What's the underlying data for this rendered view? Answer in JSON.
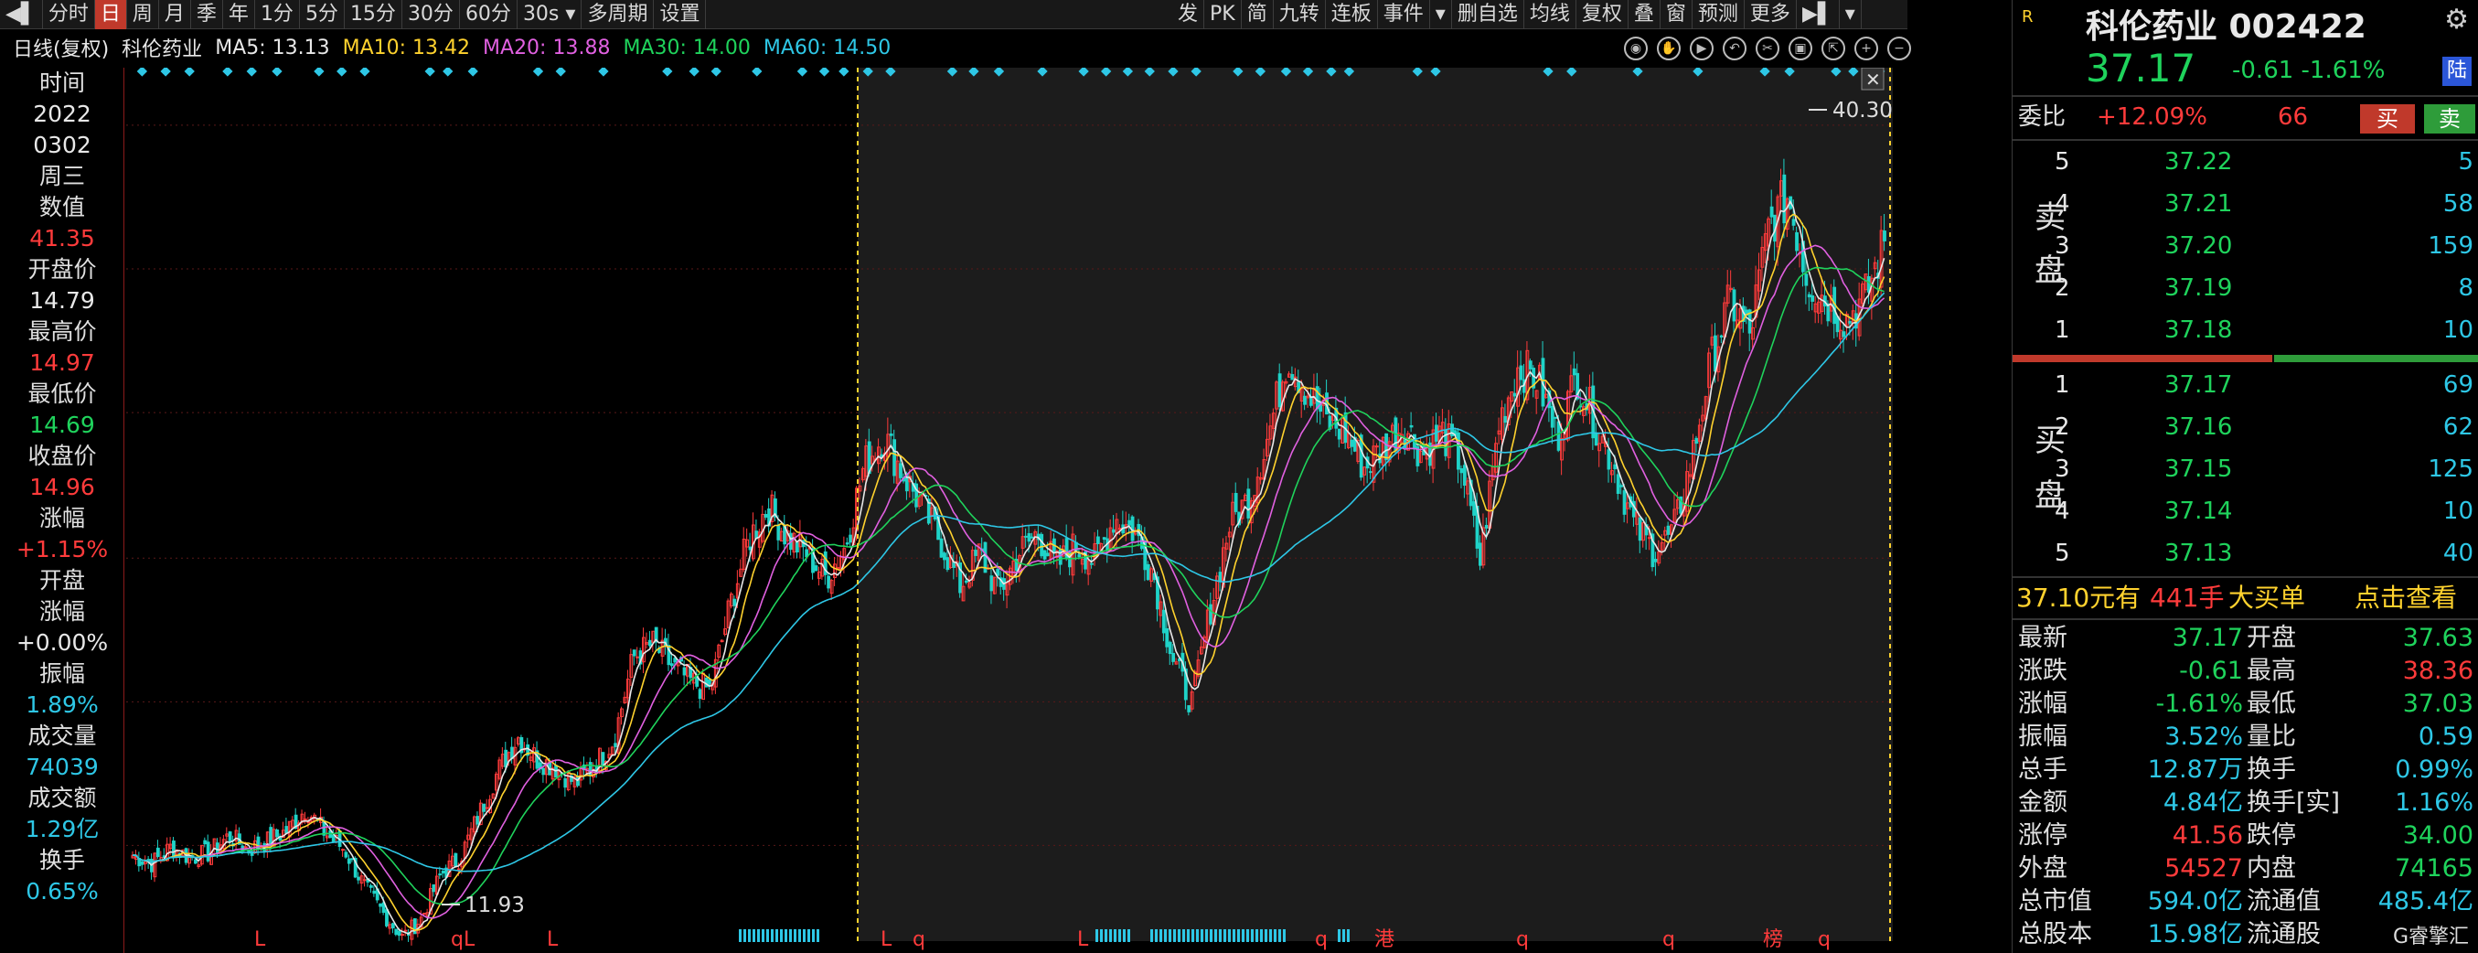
{
  "toolbar": {
    "left_items": [
      "分时",
      "日",
      "周",
      "月",
      "季",
      "年",
      "1分",
      "5分",
      "15分",
      "30分",
      "60分",
      "30s",
      "多周期",
      "设置"
    ],
    "active": "日",
    "right_items": [
      "发",
      "PK",
      "简",
      "九转",
      "连板",
      "事件",
      "删自选",
      "均线",
      "复权",
      "叠",
      "窗",
      "预测",
      "更多"
    ]
  },
  "chart_head": {
    "name": "日线(复权)",
    "stock": "科伦药业",
    "ma5": "MA5: 13.13",
    "ma10": "MA10: 13.42",
    "ma20": "MA20: 13.88",
    "ma30": "MA30: 14.00",
    "ma60": "MA60: 14.50",
    "colors": {
      "ma5": "#e8e8e8",
      "ma10": "#ffd22e",
      "ma20": "#e060e0",
      "ma30": "#1fd35c",
      "ma60": "#2ec7e6"
    }
  },
  "info": {
    "time_label": "时间",
    "year": "2022",
    "date": "0302",
    "weekday": "周三",
    "value_label": "数值",
    "value": "41.35",
    "open_label": "开盘价",
    "open": "14.79",
    "high_label": "最高价",
    "high": "14.97",
    "low_label": "最低价",
    "low": "14.69",
    "close_label": "收盘价",
    "close": "14.96",
    "chg_label": "涨幅",
    "chg": "+1.15%",
    "open_chg_label1": "开盘",
    "open_chg_label2": "涨幅",
    "open_chg": "+0.00%",
    "amp_label": "振幅",
    "amp": "1.89%",
    "vol_label": "成交量",
    "vol": "74039",
    "amt_label": "成交额",
    "amt": "1.29亿",
    "turn_label": "换手",
    "turn": "0.65%"
  },
  "chart_data": {
    "type": "candlestick",
    "price_axis": [
      "41.87",
      "36.64",
      "31.41",
      "26.11",
      "20.88",
      "15.65"
    ],
    "ylim": [
      13.5,
      42.5
    ],
    "annotations": {
      "max": "40.30",
      "min": "11.93"
    },
    "bottom_markers": [
      "L",
      "q",
      "L",
      "qL",
      "L",
      "L",
      "q",
      "L",
      "q",
      "港",
      "q",
      "q",
      "榜",
      "q"
    ],
    "close_path": [
      15.3,
      15.0,
      15.6,
      15.2,
      15.4,
      16.0,
      15.5,
      15.8,
      16.2,
      17.0,
      16.1,
      15.5,
      14.2,
      13.2,
      12.3,
      13.0,
      14.6,
      15.2,
      16.8,
      18.4,
      19.6,
      18.8,
      18.5,
      17.9,
      18.6,
      19.5,
      22.5,
      23.0,
      22.2,
      21.6,
      21.3,
      24.3,
      26.8,
      28.0,
      26.9,
      26.3,
      25.4,
      26.5,
      29.5,
      30.6,
      29.2,
      28.0,
      26.7,
      25.1,
      26.3,
      24.8,
      26.3,
      27.0,
      25.8,
      26.6,
      26.0,
      27.6,
      27.1,
      25.6,
      22.5,
      20.8,
      24.3,
      27.4,
      28.3,
      30.6,
      33.5,
      32.2,
      31.1,
      30.7,
      29.4,
      30.2,
      31.0,
      29.9,
      30.7,
      29.6,
      26.0,
      31.1,
      33.1,
      32.6,
      30.5,
      32.8,
      31.0,
      29.4,
      27.3,
      26.4,
      27.0,
      29.7,
      33.3,
      35.5,
      34.2,
      38.2,
      39.3,
      36.3,
      35.5,
      34.8,
      35.6,
      37.6
    ]
  },
  "quote": {
    "r_label": "R",
    "title": "科伦药业  002422",
    "price": "37.17",
    "change": "-0.61  -1.61%",
    "market": "陆",
    "weibi_label": "委比",
    "weibi": "+12.09%",
    "weibi_diff": "66",
    "buy_btn": "买",
    "sell_btn": "卖",
    "sell_label1": "卖",
    "sell_label2": "盘",
    "buy_label1": "买",
    "buy_label2": "盘",
    "sells": [
      {
        "n": "5",
        "p": "37.22",
        "v": "5"
      },
      {
        "n": "4",
        "p": "37.21",
        "v": "58"
      },
      {
        "n": "3",
        "p": "37.20",
        "v": "159"
      },
      {
        "n": "2",
        "p": "37.19",
        "v": "8"
      },
      {
        "n": "1",
        "p": "37.18",
        "v": "10"
      }
    ],
    "buys": [
      {
        "n": "1",
        "p": "37.17",
        "v": "69"
      },
      {
        "n": "2",
        "p": "37.16",
        "v": "62"
      },
      {
        "n": "3",
        "p": "37.15",
        "v": "125"
      },
      {
        "n": "4",
        "p": "37.14",
        "v": "10"
      },
      {
        "n": "5",
        "p": "37.13",
        "v": "40"
      }
    ],
    "trade": {
      "price": "37.10元有",
      "qty": "441手",
      "big": "大买单",
      "view": "点击查看"
    },
    "stats": [
      {
        "k1": "最新",
        "v1": "37.17",
        "c1": "green",
        "k2": "开盘",
        "v2": "37.63",
        "c2": "green"
      },
      {
        "k1": "涨跌",
        "v1": "-0.61",
        "c1": "green",
        "k2": "最高",
        "v2": "38.36",
        "c2": "red"
      },
      {
        "k1": "涨幅",
        "v1": "-1.61%",
        "c1": "green",
        "k2": "最低",
        "v2": "37.03",
        "c2": "green"
      },
      {
        "k1": "振幅",
        "v1": "3.52%",
        "c1": "cyan",
        "k2": "量比",
        "v2": "0.59",
        "c2": "cyan"
      },
      {
        "k1": "总手",
        "v1": "12.87万",
        "c1": "cyan",
        "k2": "换手",
        "v2": "0.99%",
        "c2": "cyan"
      },
      {
        "k1": "金额",
        "v1": "4.84亿",
        "c1": "cyan",
        "k2": "换手[实]",
        "v2": "1.16%",
        "c2": "cyan"
      },
      {
        "k1": "涨停",
        "v1": "41.56",
        "c1": "red",
        "k2": "跌停",
        "v2": "34.00",
        "c2": "green"
      },
      {
        "k1": "外盘",
        "v1": "54527",
        "c1": "red",
        "k2": "内盘",
        "v2": "74165",
        "c2": "green"
      },
      {
        "k1": "总市值",
        "v1": "594.0亿",
        "c1": "cyan",
        "k2": "流通值",
        "v2": "485.4亿",
        "c2": "cyan"
      },
      {
        "k1": "总股本",
        "v1": "15.98亿",
        "c1": "cyan",
        "k2": "流通股",
        "v2": "",
        "c2": "cyan"
      }
    ],
    "logo": "G睿擎汇"
  }
}
